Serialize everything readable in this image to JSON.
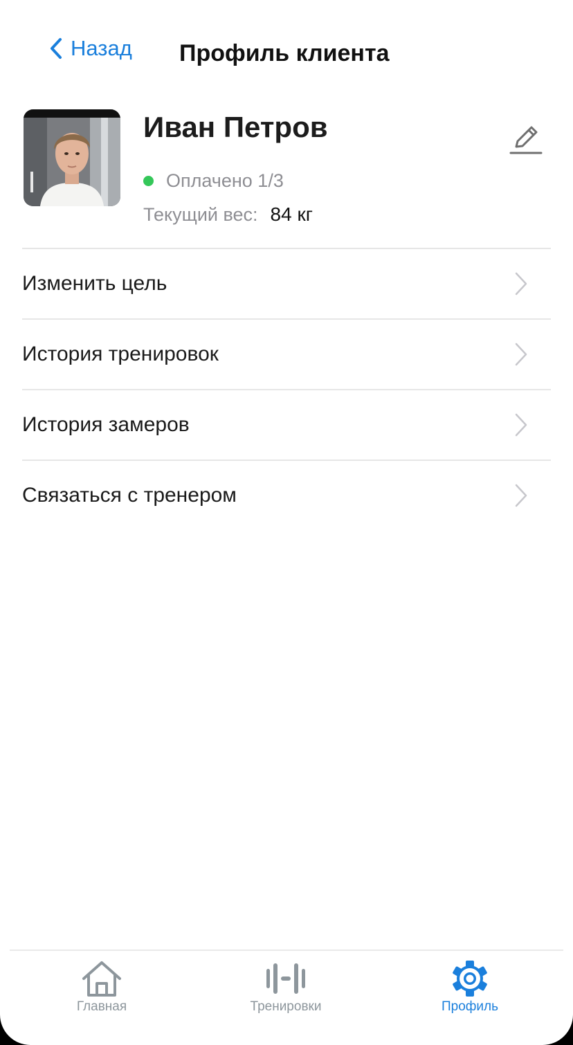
{
  "header": {
    "back_label": "Назад",
    "title": "Профиль клиента"
  },
  "profile": {
    "name": "Иван Петров",
    "status": "Оплачено 1/3",
    "status_color": "#34c759",
    "weight_label": "Текущий вес:",
    "weight_value": "84 кг"
  },
  "menu": {
    "items": [
      {
        "label": "Изменить цель"
      },
      {
        "label": "История тренировок"
      },
      {
        "label": "История замеров"
      },
      {
        "label": "Связаться с тренером"
      }
    ]
  },
  "tabbar": {
    "tabs": [
      {
        "label": "Главная",
        "icon": "home-icon",
        "active": false
      },
      {
        "label": "Тренировки",
        "icon": "dumbbell-icon",
        "active": false
      },
      {
        "label": "Профиль",
        "icon": "gear-icon",
        "active": true
      }
    ]
  },
  "colors": {
    "accent": "#1a7fdc",
    "inactive": "#8d969c"
  }
}
